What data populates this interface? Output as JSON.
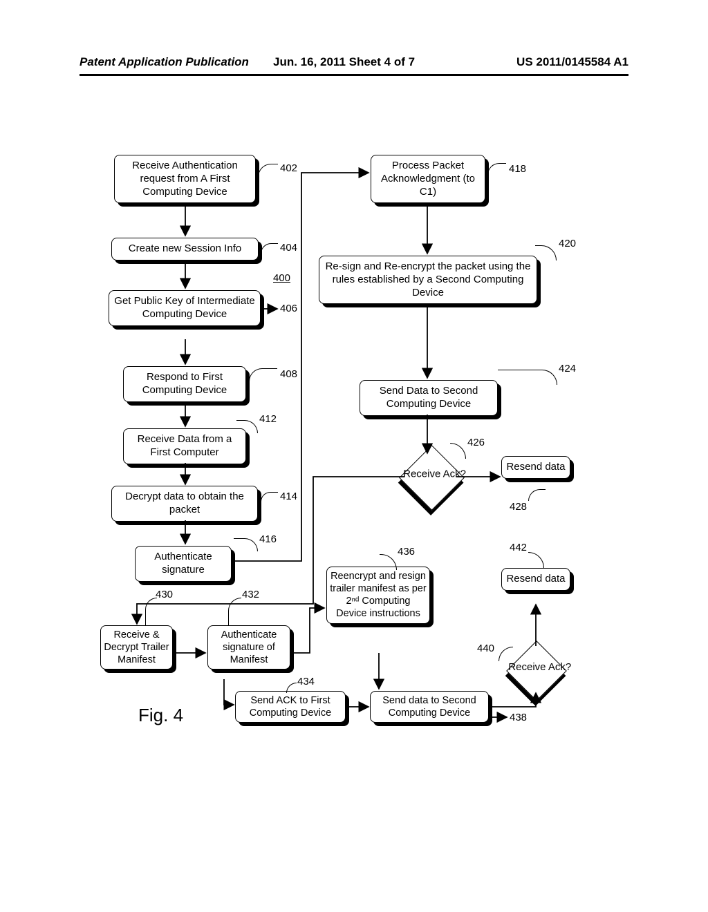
{
  "header": {
    "left": "Patent Application Publication",
    "center": "Jun. 16, 2011  Sheet 4 of 7",
    "right": "US 2011/0145584 A1"
  },
  "title_ref": "400",
  "fig_label": "Fig. 4",
  "refs": {
    "r402": "402",
    "r404": "404",
    "r406": "406",
    "r408": "408",
    "r412": "412",
    "r414": "414",
    "r416": "416",
    "r418": "418",
    "r420": "420",
    "r424": "424",
    "r426": "426",
    "r428": "428",
    "r430": "430",
    "r432": "432",
    "r434": "434",
    "r436": "436",
    "r438": "438",
    "r440": "440",
    "r442": "442"
  },
  "nodes": {
    "n402": "Receive Authentication request from A First Computing Device",
    "n404": "Create new Session Info",
    "n406": "Get Public Key of Intermediate Computing Device",
    "n408": "Respond to First Computing Device",
    "n412": "Receive Data from a First Computer",
    "n414": "Decrypt  data to obtain the packet",
    "n416": "Authenticate signature",
    "n418": "Process Packet Acknowledgment (to C1)",
    "n420": "Re-sign and Re-encrypt the packet using the rules established by a Second Computing Device",
    "n424": "Send Data to Second Computing Device",
    "n426": "Receive Ack?",
    "n428": "Resend data",
    "n430": "Receive & Decrypt Trailer Manifest",
    "n432": "Authenticate signature of Manifest",
    "n434": "Send ACK to First Computing Device",
    "n436": "Reencrypt and resign trailer manifest as per 2ⁿᵈ Computing Device instructions",
    "n438": "Send data to  Second Computing Device",
    "n440": "Receive Ack?",
    "n442": "Resend data"
  }
}
